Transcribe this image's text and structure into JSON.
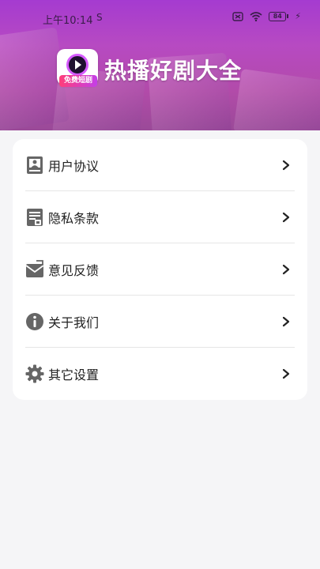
{
  "status_bar": {
    "time": "上午10:14",
    "sim_icon": "sim-s-icon",
    "battery_level": "84"
  },
  "header": {
    "logo_tag": "免费短剧",
    "title": "热播好剧大全"
  },
  "menu": {
    "items": [
      {
        "label": "用户协议",
        "icon": "user-agreement-icon"
      },
      {
        "label": "隐私条款",
        "icon": "privacy-policy-icon"
      },
      {
        "label": "意见反馈",
        "icon": "feedback-icon"
      },
      {
        "label": "关于我们",
        "icon": "info-icon"
      },
      {
        "label": "其它设置",
        "icon": "gear-icon"
      }
    ]
  },
  "colors": {
    "banner": "#a53bd0",
    "icon_gray": "#666666",
    "chevron": "#222222"
  }
}
